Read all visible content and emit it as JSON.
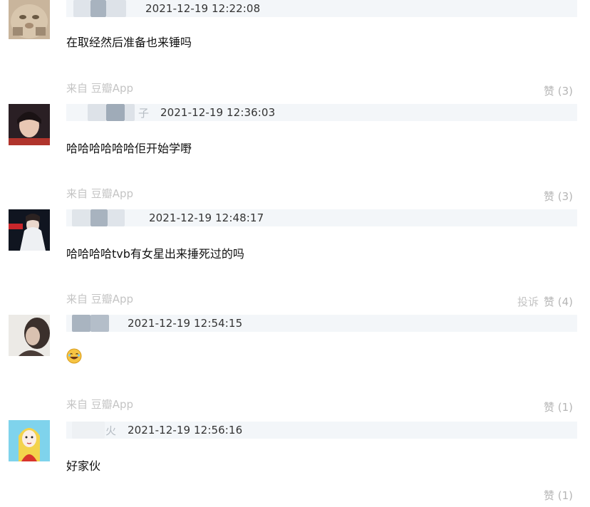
{
  "comments": [
    {
      "avatar": "cat-avatar",
      "time": "2021-12-19 12:22:08",
      "text": "在取经然后准备也来锤吗",
      "source": "来自 豆瓣App",
      "likes": "赞 (3)"
    },
    {
      "avatar": "person-avatar",
      "name_fragment": "子",
      "time": "2021-12-19 12:36:03",
      "text": "哈哈哈哈哈哈佢开始学嘢",
      "source": "来自 豆瓣App",
      "likes": "赞 (3)"
    },
    {
      "avatar": "bride-avatar",
      "time": "2021-12-19 12:48:17",
      "text": "哈哈哈哈tvb有女星出来捶死过的吗",
      "source": "来自 豆瓣App",
      "report": "投诉",
      "likes": "赞 (4)"
    },
    {
      "avatar": "profile-avatar",
      "time": "2021-12-19 12:54:15",
      "text_icon": "laughing-emoji-icon",
      "source": "来自 豆瓣App",
      "likes": "赞 (1)"
    },
    {
      "avatar": "cartoon-avatar",
      "name_fragment": "火",
      "time": "2021-12-19 12:56:16",
      "text": "好家伙",
      "likes": "赞 (1)"
    }
  ]
}
